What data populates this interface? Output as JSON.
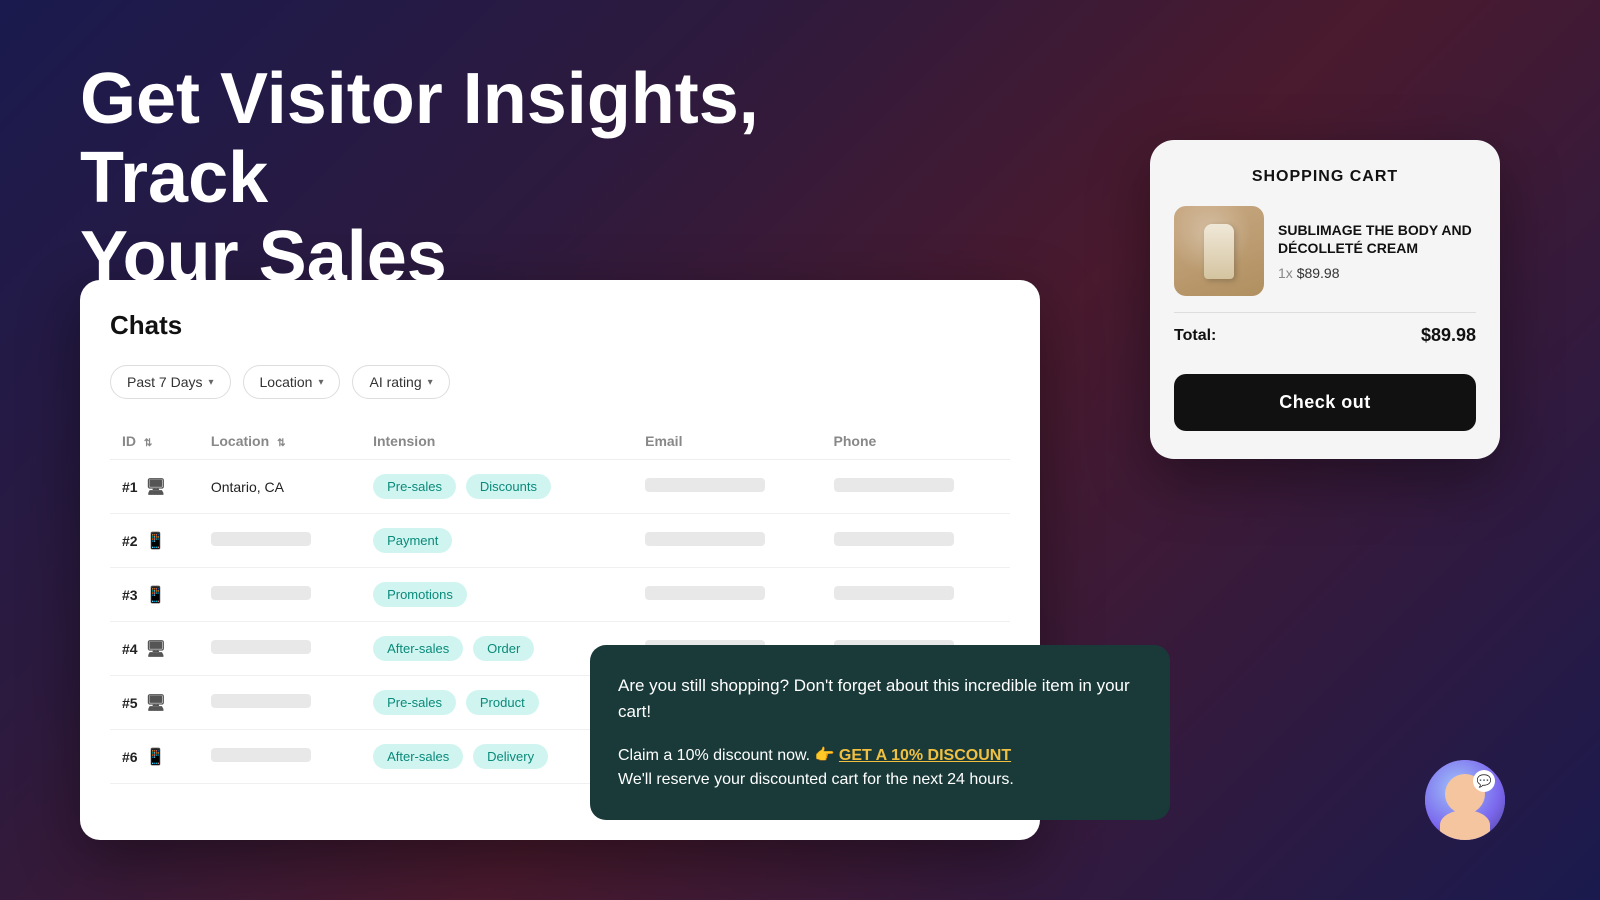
{
  "hero": {
    "line1": "Get Visitor Insights, Track",
    "line2": "Your Sales"
  },
  "chats": {
    "title": "Chats",
    "filters": [
      {
        "label": "Past 7 Days",
        "id": "filter-period"
      },
      {
        "label": "Location",
        "id": "filter-location"
      },
      {
        "label": "AI rating",
        "id": "filter-ai-rating"
      }
    ],
    "columns": [
      "ID",
      "Location",
      "Intension",
      "Email",
      "Phone"
    ],
    "rows": [
      {
        "id": "#1",
        "device": "monitor",
        "location": "Ontario, CA",
        "tags": [
          "Pre-sales",
          "Discounts"
        ],
        "hasEmail": true,
        "hasPhone": true
      },
      {
        "id": "#2",
        "device": "phone",
        "location": "",
        "tags": [
          "Payment"
        ],
        "hasEmail": false,
        "hasPhone": false
      },
      {
        "id": "#3",
        "device": "phone",
        "location": "",
        "tags": [
          "Promotions"
        ],
        "hasEmail": false,
        "hasPhone": false
      },
      {
        "id": "#4",
        "device": "monitor",
        "location": "",
        "tags": [
          "After-sales",
          "Order"
        ],
        "hasEmail": false,
        "hasPhone": false
      },
      {
        "id": "#5",
        "device": "monitor",
        "location": "",
        "tags": [
          "Pre-sales",
          "Product"
        ],
        "hasEmail": false,
        "hasPhone": false
      },
      {
        "id": "#6",
        "device": "phone",
        "location": "",
        "tags": [
          "After-sales",
          "Delivery"
        ],
        "hasEmail": false,
        "hasPhone": false
      }
    ]
  },
  "cart": {
    "title": "SHOPPING CART",
    "product_name": "SUBLIMAGE THE BODY AND DÉCOLLETÉ CREAM",
    "quantity_label": "1x",
    "price": "$89.98",
    "total_label": "Total:",
    "total_price": "$89.98",
    "checkout_label": "Check out"
  },
  "chat_bubble": {
    "line1": "Are you still shopping? Don't forget about this incredible item in your cart!",
    "line2_prefix": "Claim a 10% discount now. 👉",
    "link_text": "GET A 10% DISCOUNT",
    "line3": "We'll reserve your discounted cart for the next 24 hours."
  }
}
